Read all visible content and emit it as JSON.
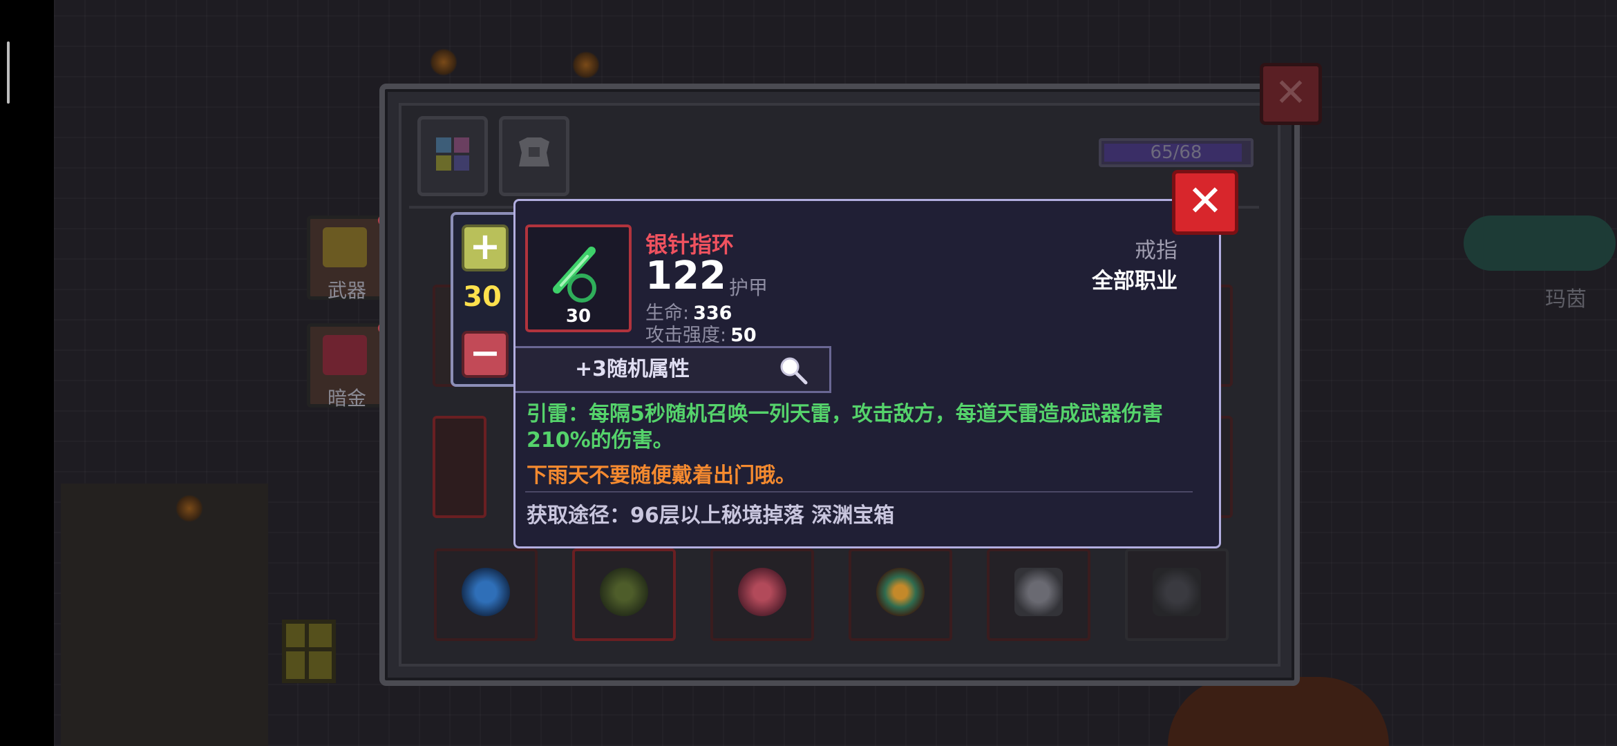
{
  "background": {
    "npc_name": "玛茵"
  },
  "side_tabs": [
    {
      "label": "武器",
      "icon": "weapon-chest-icon"
    },
    {
      "label": "暗金",
      "icon": "dark-gold-chest-icon"
    }
  ],
  "panel": {
    "close_icon": "close-icon",
    "tab_icons": [
      "equipment-grid-icon",
      "armor-icon"
    ],
    "capacity": "65/68",
    "capacity_fraction": 0.956,
    "slot_icons": [
      "blue-orb-icon",
      "green-amulet-icon",
      "red-fang-icon",
      "gem-ring-icon",
      "gray-cloak-icon",
      "locked-slot-icon"
    ]
  },
  "stepper": {
    "plus_label": "+",
    "quantity": "30",
    "minus_label": "−"
  },
  "tooltip": {
    "name": "银针指环",
    "level": "30",
    "power_value": "122",
    "power_label": "护甲",
    "stats": [
      {
        "label": "生命:",
        "value": "336"
      },
      {
        "label": "攻击强度:",
        "value": "50"
      }
    ],
    "type": "戒指",
    "class": "全部职业",
    "random_attr": "+3随机属性",
    "skill_text": "引雷：每隔5秒随机召唤一列天雷，攻击敌方，每道天雷造成武器伤害210%的伤害。",
    "flavor_text": "下雨天不要随便戴着出门哦。",
    "source_text": "获取途径：96层以上秘境掉落 深渊宝箱",
    "colors": {
      "name": "#f0525f",
      "skill": "#55d36b",
      "flavor": "#f58a2f",
      "close": "#d8262c"
    }
  }
}
